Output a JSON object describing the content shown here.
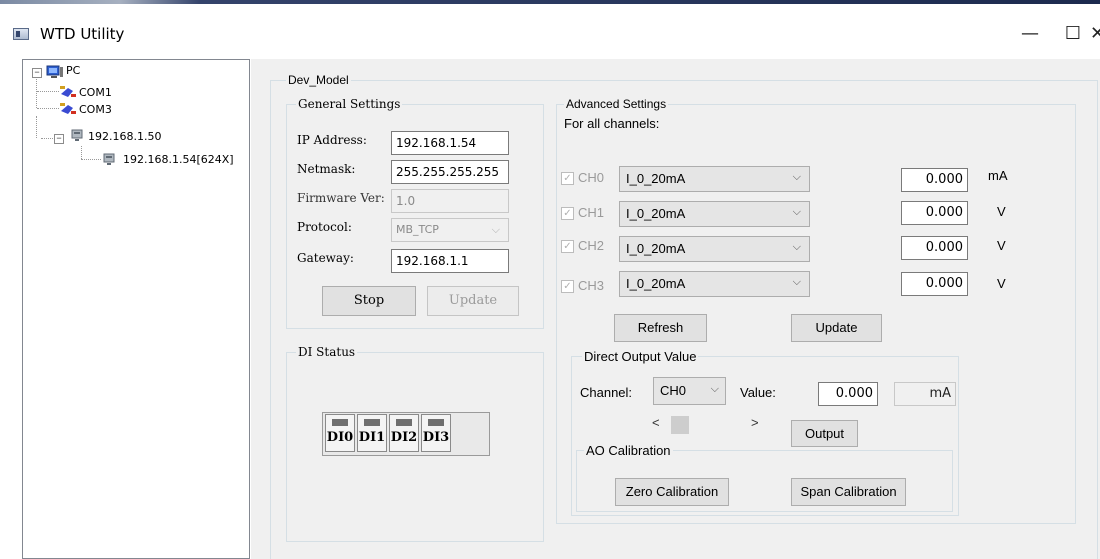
{
  "window": {
    "title": "WTD Utility",
    "minimize_glyph": "—",
    "maximize_glyph": "☐",
    "close_glyph": "✕"
  },
  "tree": {
    "root": "PC",
    "items": [
      "COM1",
      "COM3",
      "192.168.1.50",
      "192.168.1.54[624X]"
    ]
  },
  "dev_model": {
    "label": "Dev_Model",
    "general": {
      "title": "General Settings",
      "ip_label": "IP Address:",
      "ip_value": "192.168.1.54",
      "netmask_label": "Netmask:",
      "netmask_value": "255.255.255.255",
      "firmware_label": "Firmware Ver:",
      "firmware_value": "1.0",
      "protocol_label": "Protocol:",
      "protocol_value": "MB_TCP",
      "gateway_label": "Gateway:",
      "gateway_value": "192.168.1.1",
      "stop_label": "Stop",
      "update_label": "Update"
    },
    "di_status": {
      "title": "DI Status",
      "inputs": [
        "DI0",
        "DI1",
        "DI2",
        "DI3"
      ]
    },
    "advanced": {
      "title": "Advanced Settings",
      "subtitle": "For all channels:",
      "channels": [
        {
          "name": "CH0",
          "range": "I_0_20mA",
          "value": "0.000",
          "unit": "mA"
        },
        {
          "name": "CH1",
          "range": "I_0_20mA",
          "value": "0.000",
          "unit": "V"
        },
        {
          "name": "CH2",
          "range": "I_0_20mA",
          "value": "0.000",
          "unit": "V"
        },
        {
          "name": "CH3",
          "range": "I_0_20mA",
          "value": "0.000",
          "unit": "V"
        }
      ],
      "refresh_label": "Refresh",
      "update_label": "Update"
    },
    "direct_output": {
      "title": "Direct Output Value",
      "channel_label": "Channel:",
      "channel_value": "CH0",
      "value_label": "Value:",
      "value": "0.000",
      "unit": "mA",
      "scroll_left": "<",
      "scroll_right": ">",
      "output_label": "Output"
    },
    "ao_calibration": {
      "title": "AO Calibration",
      "zero_label": "Zero Calibration",
      "span_label": "Span Calibration"
    }
  },
  "icons": {
    "pc": "computer-icon",
    "com": "serial-port-icon",
    "net": "network-device-icon"
  },
  "colors": {
    "client_bg": "#f0f0f0",
    "group_border": "#d5dfe5",
    "button_bg": "#e1e1e1"
  }
}
